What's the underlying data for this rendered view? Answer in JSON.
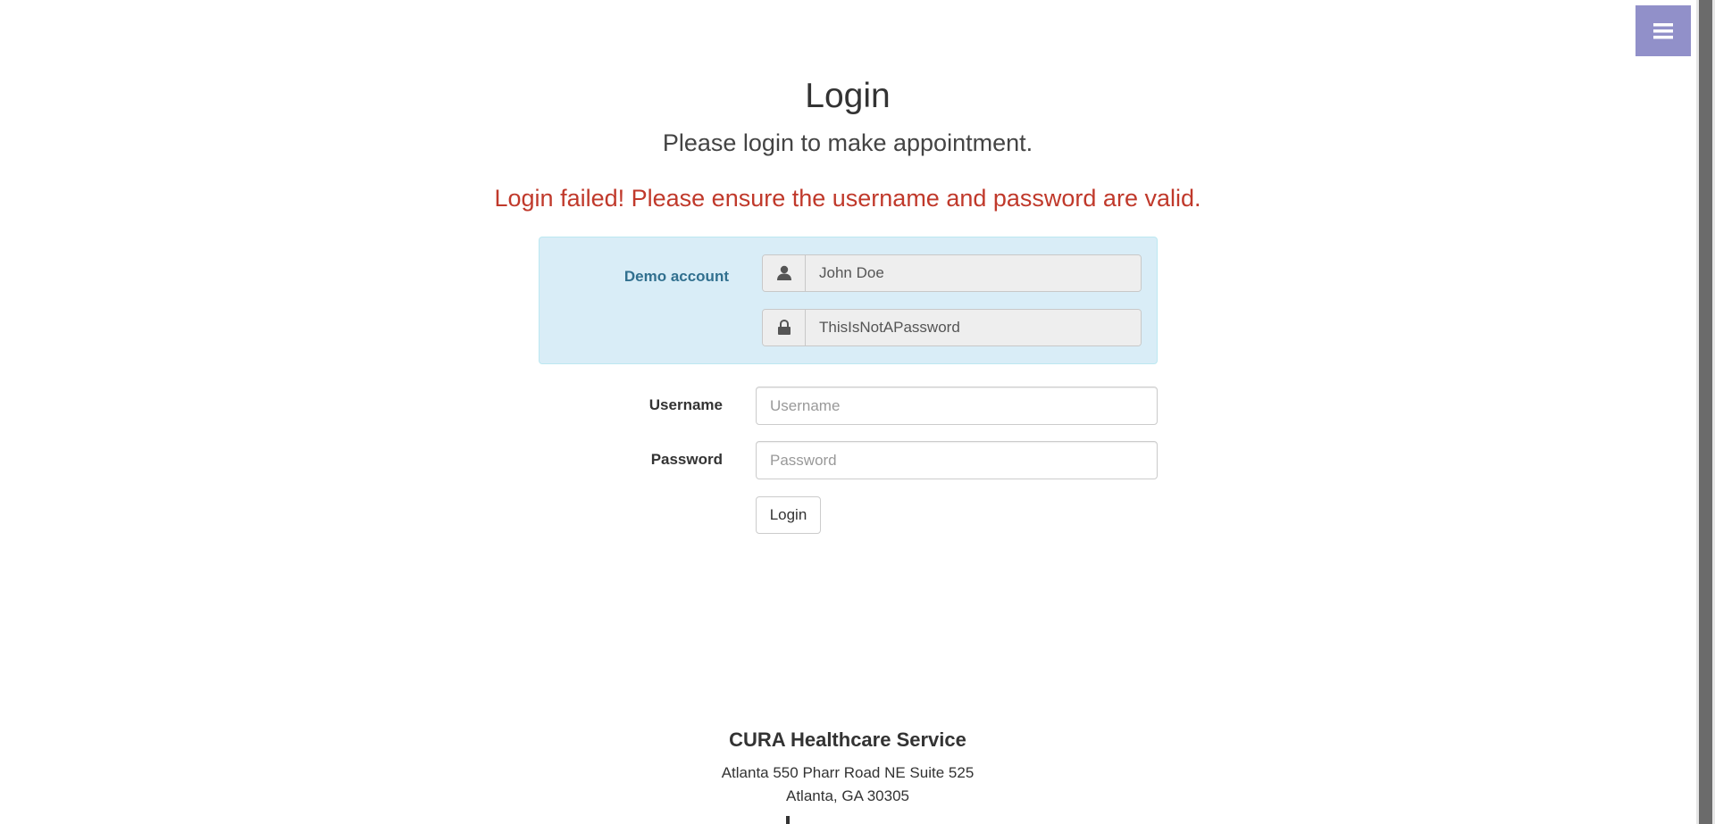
{
  "menu": {
    "icon": "hamburger-menu-icon"
  },
  "header": {
    "title": "Login",
    "subtitle": "Please login to make appointment.",
    "error": "Login failed! Please ensure the username and password are valid."
  },
  "demo_account": {
    "label": "Demo account",
    "username_value": "John Doe",
    "password_value": "ThisIsNotAPassword",
    "user_icon": "user-icon",
    "lock_icon": "lock-icon"
  },
  "form": {
    "username_label": "Username",
    "username_placeholder": "Username",
    "password_label": "Password",
    "password_placeholder": "Password",
    "login_button": "Login"
  },
  "footer": {
    "company": "CURA Healthcare Service",
    "address_line1": "Atlanta 550 Pharr Road NE Suite 525",
    "address_line2": "Atlanta, GA 30305"
  },
  "colors": {
    "menu_bg": "#9190c9",
    "error": "#c0392b",
    "demo_panel_bg": "#d9edf7",
    "demo_label": "#31708f"
  }
}
